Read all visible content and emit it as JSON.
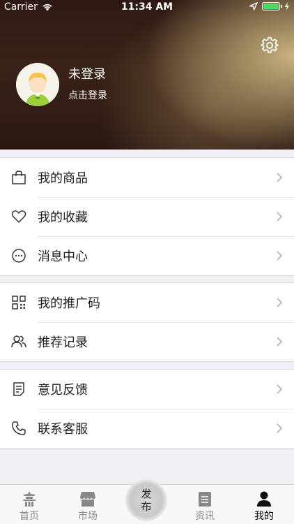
{
  "status_bar": {
    "carrier": "Carrier",
    "time": "11:34 AM"
  },
  "profile": {
    "name": "未登录",
    "hint": "点击登录"
  },
  "groups": [
    {
      "items": [
        {
          "label": "我的商品",
          "icon": "shopping-bag-icon"
        },
        {
          "label": "我的收藏",
          "icon": "heart-icon"
        },
        {
          "label": "消息中心",
          "icon": "message-icon"
        }
      ]
    },
    {
      "items": [
        {
          "label": "我的推广码",
          "icon": "qrcode-icon"
        },
        {
          "label": "推荐记录",
          "icon": "users-icon"
        }
      ]
    },
    {
      "items": [
        {
          "label": "意见反馈",
          "icon": "document-icon"
        },
        {
          "label": "联系客服",
          "icon": "phone-icon"
        }
      ]
    }
  ],
  "tabbar": {
    "home": "首页",
    "market": "市场",
    "publish_line1": "发",
    "publish_line2": "布",
    "news": "资讯",
    "mine": "我的"
  },
  "colors": {
    "battery": "#4cd964",
    "background": "#efeff4"
  }
}
